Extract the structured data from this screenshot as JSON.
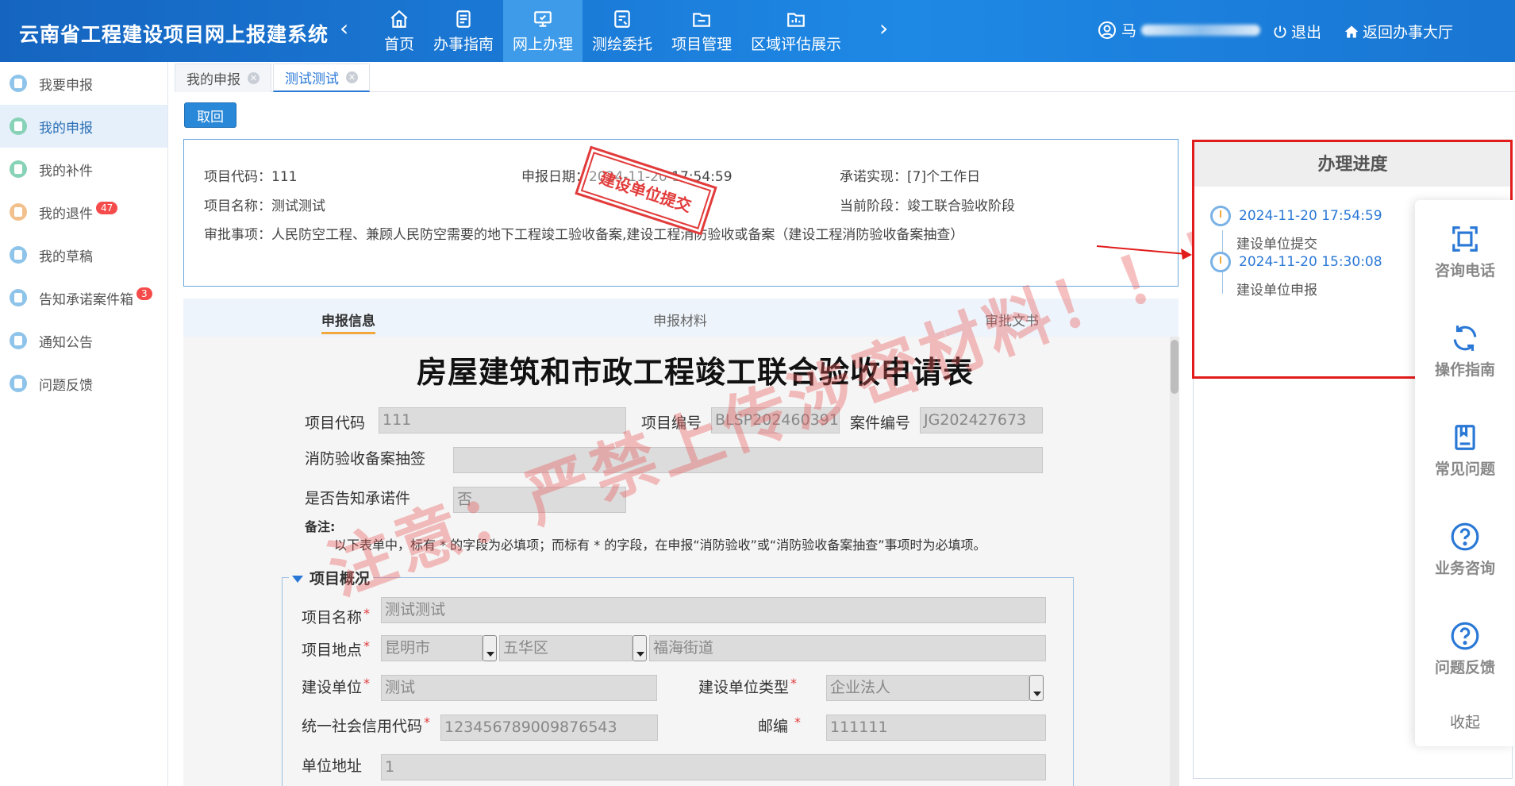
{
  "header": {
    "title": "云南省工程建设项目网上报建系统",
    "nav": [
      {
        "label": "首页",
        "icon": "home-icon"
      },
      {
        "label": "办事指南",
        "icon": "guide-icon"
      },
      {
        "label": "网上办理",
        "icon": "monitor-icon",
        "active": true
      },
      {
        "label": "测绘委托",
        "icon": "survey-icon"
      },
      {
        "label": "项目管理",
        "icon": "folder-icon"
      },
      {
        "label": "区域评估展示",
        "icon": "region-icon"
      }
    ],
    "user_name": "马",
    "logout": "退出",
    "return_hall": "返回办事大厅"
  },
  "sidebar": {
    "items": [
      {
        "label": "我要申报"
      },
      {
        "label": "我的申报",
        "active": true
      },
      {
        "label": "我的补件"
      },
      {
        "label": "我的退件",
        "badge": "47"
      },
      {
        "label": "我的草稿"
      },
      {
        "label": "告知承诺案件箱",
        "badge": "3"
      },
      {
        "label": "通知公告"
      },
      {
        "label": "问题反馈"
      }
    ]
  },
  "tabs": [
    {
      "label": "我的申报"
    },
    {
      "label": "测试测试",
      "active": true
    }
  ],
  "back_button": "取回",
  "info": {
    "project_code_label": "项目代码：",
    "project_code": "111",
    "report_date_label": "申报日期：",
    "report_date": "2024-11-20 17:54:59",
    "promise_label": "承诺实现：",
    "promise": "[7]个工作日",
    "project_name_label": "项目名称：",
    "project_name": "测试测试",
    "stage_label": "当前阶段：",
    "stage": "竣工联合验收阶段",
    "approval_label": "审批事项：",
    "approval": "人民防空工程、兼顾人民防空需要的地下工程竣工验收备案,建设工程消防验收或备案（建设工程消防验收备案抽查）",
    "stamp": "建设单位提交"
  },
  "subtabs": [
    {
      "label": "申报信息",
      "active": true
    },
    {
      "label": "申报材料"
    },
    {
      "label": "审批文书"
    }
  ],
  "form": {
    "title": "房屋建筑和市政工程竣工联合验收申请表",
    "code_label": "项目代码",
    "code_value": "111",
    "number_label": "项目编号",
    "number_value": "BLSP202460391",
    "case_label": "案件编号",
    "case_value": "JG202427673",
    "fire_label": "消防验收备案抽签",
    "fire_value": "",
    "notify_label": "是否告知承诺件",
    "notify_value": "否",
    "note_label": "备注:",
    "note_text": "以下表单中，标有   *  的字段为必填项；而标有  * 的字段，在申报“消防验收”或“消防验收备案抽查”事项时为必填项。",
    "section_title": "项目概况",
    "name_label": "项目名称",
    "name_value": "测试测试",
    "location_label": "项目地点",
    "city": "昆明市",
    "district": "五华区",
    "street": "福海街道",
    "unit_label": "建设单位",
    "unit_value": "测试",
    "unit_type_label": "建设单位类型",
    "unit_type_value": "企业法人",
    "credit_label": "统一社会信用代码",
    "credit_value": "123456789009876543",
    "postcode_label": "邮编",
    "postcode_value": "111111",
    "address_label": "单位地址",
    "address_value": "1",
    "required_mark": "*"
  },
  "watermark": "注意：严禁上传涉密材料！！！",
  "progress": {
    "title": "办理进度",
    "items": [
      {
        "time": "2024-11-20 17:54:59",
        "desc": "建设单位提交"
      },
      {
        "time": "2024-11-20 15:30:08",
        "desc": "建设单位申报"
      }
    ]
  },
  "float_bar": {
    "items": [
      {
        "label": "咨询电话",
        "icon": "scan-icon"
      },
      {
        "label": "操作指南",
        "icon": "refresh-icon"
      },
      {
        "label": "常见问题",
        "icon": "book-icon"
      },
      {
        "label": "业务咨询",
        "icon": "question-icon"
      },
      {
        "label": "问题反馈",
        "icon": "question-circle-icon"
      }
    ],
    "collapse": "收起"
  },
  "colors": {
    "header_blue": "#1976d2",
    "active_blue": "#2a78d6",
    "highlight_red": "#e21b1b",
    "badge_red": "#f54b4b"
  }
}
